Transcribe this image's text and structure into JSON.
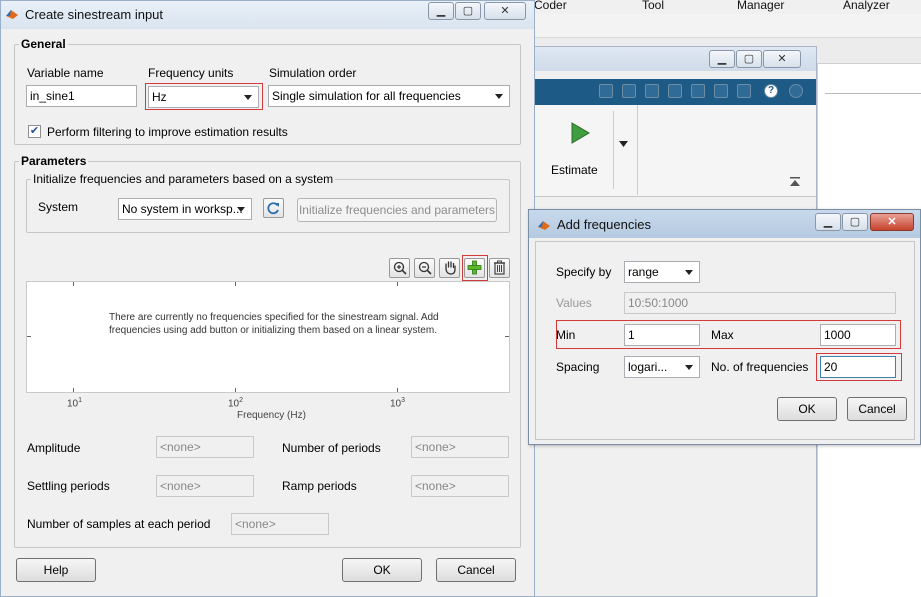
{
  "background": {
    "menu": [
      "Coder",
      "Tool",
      "Manager",
      "Analyzer"
    ],
    "ribbon": {
      "estimate_label": "Estimate"
    }
  },
  "main_dialog": {
    "title": "Create sinestream input",
    "general": {
      "legend": "General",
      "variable_name_label": "Variable name",
      "variable_name_value": "in_sine1",
      "frequency_units_label": "Frequency units",
      "frequency_units_value": "Hz",
      "simulation_order_label": "Simulation order",
      "simulation_order_value": "Single simulation for all frequencies",
      "filter_checkbox_label": "Perform filtering to improve estimation results",
      "filter_checked": true
    },
    "parameters": {
      "legend": "Parameters",
      "init_legend": "Initialize frequencies and parameters based on a system",
      "system_label": "System",
      "system_value": "No system in worksp...",
      "init_button": "Initialize frequencies and parameters",
      "plot": {
        "message": "There are currently no frequencies specified for the sinestream signal. Add frequencies using add button or initializing them based on a linear system.",
        "xlabel": "Frequency (Hz)",
        "ticks": [
          {
            "base": "10",
            "exp": "1"
          },
          {
            "base": "10",
            "exp": "2"
          },
          {
            "base": "10",
            "exp": "3"
          }
        ]
      },
      "amplitude_label": "Amplitude",
      "amplitude_value": "<none>",
      "num_periods_label": "Number of periods",
      "num_periods_value": "<none>",
      "settling_label": "Settling periods",
      "settling_value": "<none>",
      "ramp_label": "Ramp periods",
      "ramp_value": "<none>",
      "samples_label": "Number of samples at each period",
      "samples_value": "<none>"
    },
    "buttons": {
      "help": "Help",
      "ok": "OK",
      "cancel": "Cancel"
    }
  },
  "add_freq_dialog": {
    "title": "Add frequencies",
    "specify_by_label": "Specify by",
    "specify_by_value": "range",
    "values_label": "Values",
    "values_value": "10:50:1000",
    "min_label": "Min",
    "min_value": "1",
    "max_label": "Max",
    "max_value": "1000",
    "spacing_label": "Spacing",
    "spacing_value": "logari...",
    "num_freq_label": "No. of frequencies",
    "num_freq_value": "20",
    "ok": "OK",
    "cancel": "Cancel"
  }
}
